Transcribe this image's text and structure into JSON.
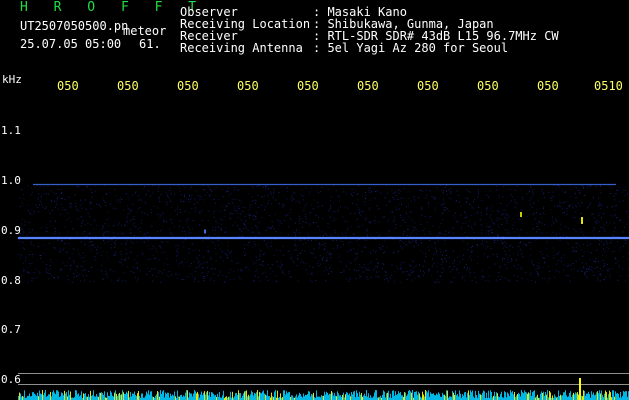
{
  "header": {
    "title": "H R O F F T",
    "filename": "UT2507050500.pn",
    "meteor_label": "meteor",
    "datetime": "25.07.05 05:00",
    "count": "61."
  },
  "info": [
    {
      "label": "Observer",
      "value": ": Masaki Kano"
    },
    {
      "label": "Receiving Location",
      "value": ": Shibukawa, Gunma, Japan"
    },
    {
      "label": "Receiver",
      "value": ": RTL-SDR SDR# 43dB L15 96.7MHz CW"
    },
    {
      "label": "Receiving Antenna",
      "value": ": 5el Yagi Az 280 for Seoul"
    }
  ],
  "axis": {
    "unit": "kHz",
    "x_ticks": [
      "050",
      "050",
      "050",
      "050",
      "050",
      "050",
      "050",
      "050",
      "050",
      "0510"
    ],
    "y_ticks": [
      "1.1",
      "1.0",
      "0.9",
      "0.8",
      "0.7",
      "0.6"
    ]
  },
  "spectrogram": {
    "freq_range_khz": [
      0.58,
      1.17
    ],
    "carrier_khz": 0.888,
    "band_top_khz": 0.995,
    "band_bottom_khz": 0.8,
    "ref_lines_khz": [
      0.617,
      0.595
    ],
    "colors": {
      "carrier": "#4477ff",
      "noise": "#1a2a99",
      "ref": "#ffffff",
      "baseline": "#00ccff",
      "spike": "#ffff00"
    }
  }
}
